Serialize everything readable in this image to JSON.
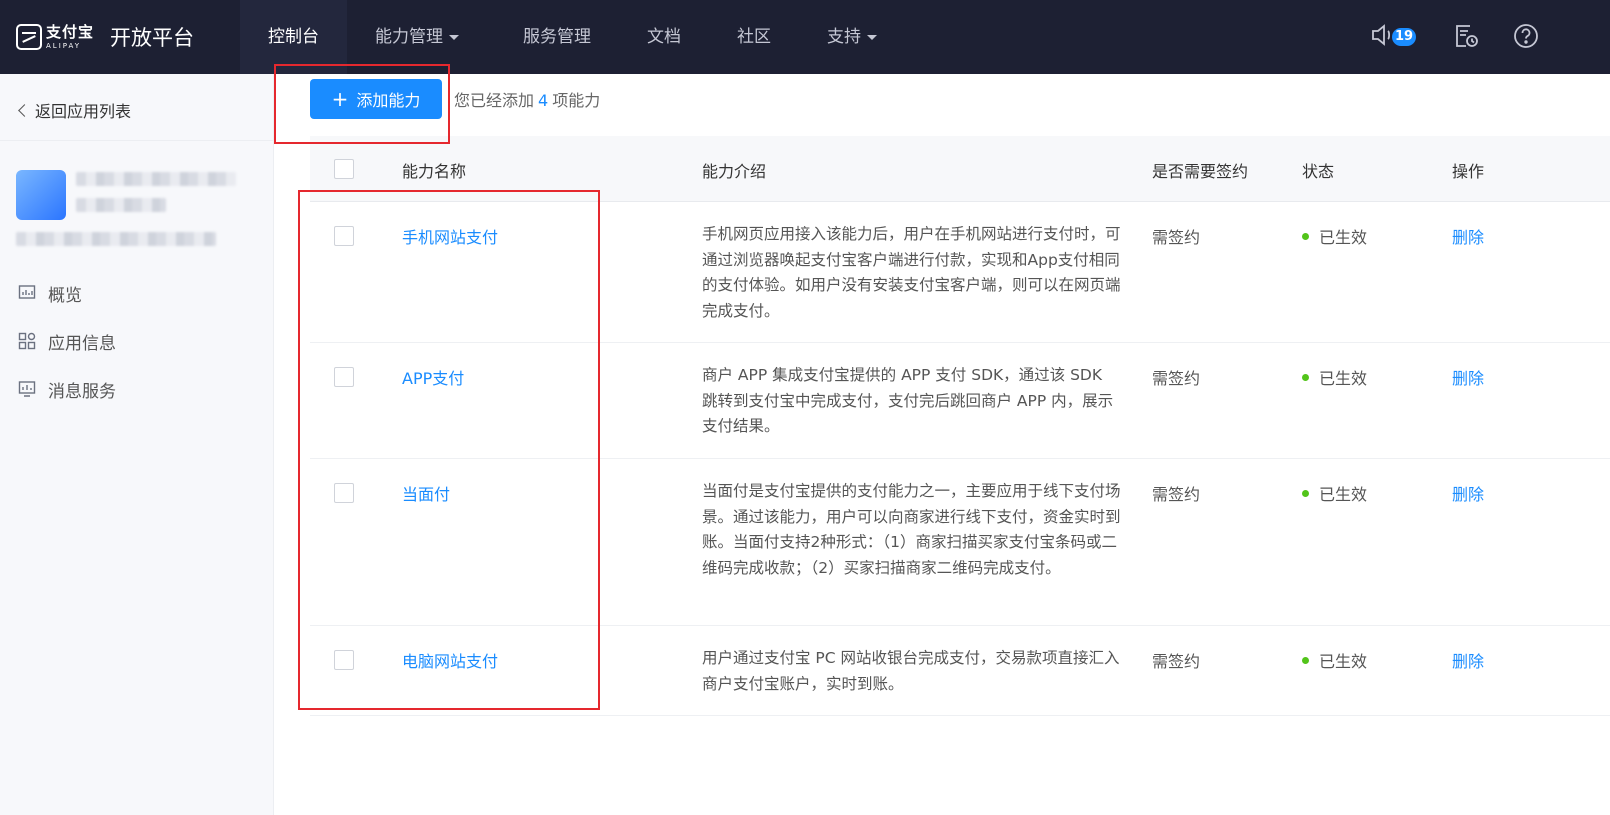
{
  "header": {
    "brand_cn": "支付宝",
    "brand_en": "ALIPAY",
    "platform": "开放平台",
    "nav": [
      {
        "label": "控制台",
        "active": true,
        "dropdown": false
      },
      {
        "label": "能力管理",
        "active": false,
        "dropdown": true
      },
      {
        "label": "服务管理",
        "active": false,
        "dropdown": false
      },
      {
        "label": "文档",
        "active": false,
        "dropdown": false
      },
      {
        "label": "社区",
        "active": false,
        "dropdown": false
      },
      {
        "label": "支持",
        "active": false,
        "dropdown": true
      }
    ],
    "notification_count": "19",
    "icons": [
      "speaker-icon",
      "document-clock-icon",
      "help-icon"
    ]
  },
  "sidebar": {
    "back_label": "返回应用列表",
    "menu": [
      {
        "label": "概览",
        "icon": "chart-icon"
      },
      {
        "label": "应用信息",
        "icon": "grid-icon"
      },
      {
        "label": "消息服务",
        "icon": "message-chart-icon"
      }
    ]
  },
  "main": {
    "add_button": "添加能力",
    "added_prefix": "您已经添加",
    "added_count": "4",
    "added_suffix": "项能力",
    "columns": {
      "name": "能力名称",
      "intro": "能力介绍",
      "sign": "是否需要签约",
      "status": "状态",
      "op": "操作"
    },
    "rows": [
      {
        "name": "手机网站支付",
        "desc": "手机网页应用接入该能力后，用户在手机网站进行支付时，可通过浏览器唤起支付宝客户端进行付款，实现和App支付相同的支付体验。如用户没有安装支付宝客户端，则可以在网页端完成支付。",
        "sign": "需签约",
        "status": "已生效",
        "op": "删除"
      },
      {
        "name": "APP支付",
        "desc": "商户 APP 集成支付宝提供的 APP 支付 SDK，通过该 SDK 跳转到支付宝中完成支付，支付完后跳回商户 APP 内，展示支付结果。",
        "sign": "需签约",
        "status": "已生效",
        "op": "删除"
      },
      {
        "name": "当面付",
        "desc": "当面付是支付宝提供的支付能力之一，主要应用于线下支付场景。通过该能力，用户可以向商家进行线下支付，资金实时到账。当面付支持2种形式：（1）商家扫描买家支付宝条码或二维码完成收款；（2）买家扫描商家二维码完成支付。",
        "sign": "需签约",
        "status": "已生效",
        "op": "删除"
      },
      {
        "name": "电脑网站支付",
        "desc": "用户通过支付宝 PC 网站收银台完成支付，交易款项直接汇入商户支付宝账户，实时到账。",
        "sign": "需签约",
        "status": "已生效",
        "op": "删除"
      }
    ],
    "colors": {
      "accent": "#1a8cff",
      "topbar": "#1d2033",
      "highlight": "#e5282e",
      "status_ok": "#52c41a"
    }
  }
}
